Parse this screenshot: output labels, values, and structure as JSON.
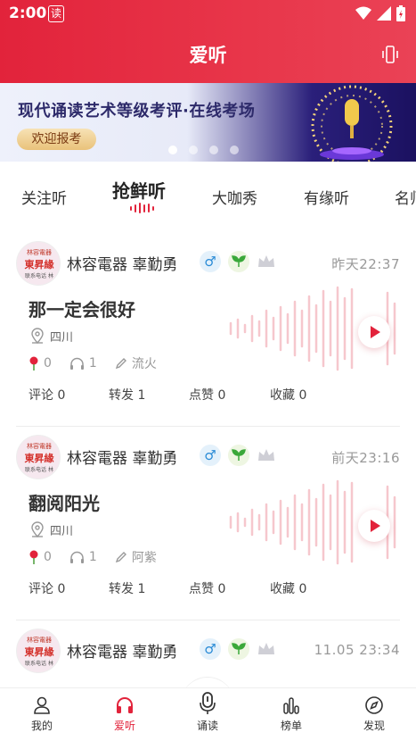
{
  "status": {
    "time": "2:00",
    "reader_icon_text": "读"
  },
  "header": {
    "title": "爱听"
  },
  "banner": {
    "headline": "现代诵读艺术等级考评·在线考场",
    "button": "欢迎报考",
    "dots_total": 4,
    "dots_active": 1
  },
  "tabs": [
    "关注听",
    "抢鲜听",
    "大咖秀",
    "有缘听",
    "名师"
  ],
  "active_tab": "抢鲜听",
  "avatar_text": {
    "line1": "林容電器",
    "line2": "東昇緣",
    "line3": "联系电话 林"
  },
  "posts": [
    {
      "user": "林容電器   辜勤勇",
      "gender": "♂",
      "date": "昨天22:37",
      "title": "那一定会很好",
      "location": "四川",
      "flowers": "0",
      "listens": "1",
      "author": "流火",
      "comments": "评论 0",
      "reposts": "转发 1",
      "likes": "点赞 0",
      "favorites": "收藏 0"
    },
    {
      "user": "林容電器   辜勤勇",
      "gender": "♂",
      "date": "前天23:16",
      "title": "翻阅阳光",
      "location": "四川",
      "flowers": "0",
      "listens": "1",
      "author": "阿紫",
      "comments": "评论 0",
      "reposts": "转发 1",
      "likes": "点赞 0",
      "favorites": "收藏 0"
    },
    {
      "user": "林容電器   辜勤勇",
      "gender": "♂",
      "date": "11.05 23:34"
    }
  ],
  "bottom_nav": [
    {
      "label": "我的",
      "icon": "person-icon"
    },
    {
      "label": "爱听",
      "icon": "headphones-icon"
    },
    {
      "label": "诵读",
      "icon": "microphone-icon"
    },
    {
      "label": "榜单",
      "icon": "bar-chart-icon"
    },
    {
      "label": "发现",
      "icon": "compass-icon"
    }
  ],
  "colors": {
    "brand": "#e2233b",
    "muted": "#999999"
  }
}
